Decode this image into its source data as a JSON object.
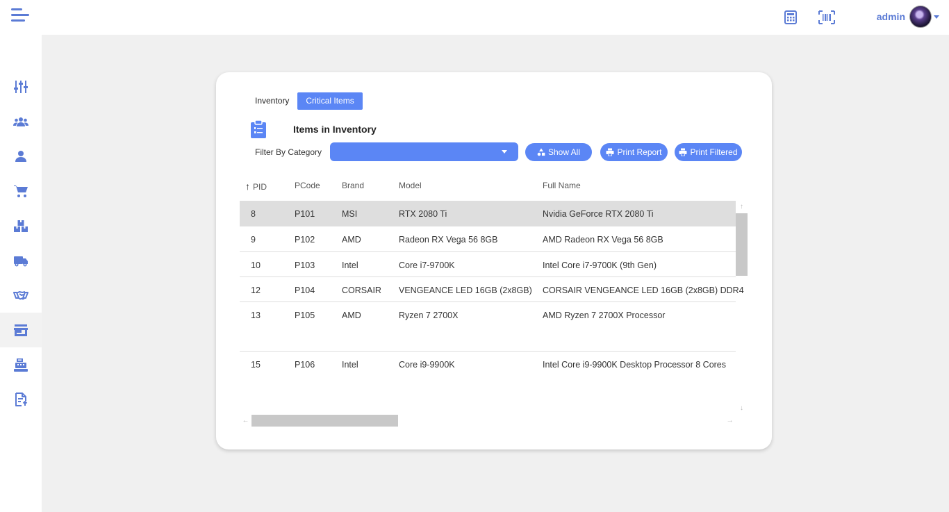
{
  "topbar": {
    "username": "admin"
  },
  "tabs": [
    {
      "label": "Inventory"
    },
    {
      "label": "Critical Items"
    }
  ],
  "page": {
    "title": "Items in Inventory",
    "filter_label": "Filter By Category",
    "filter_value": "",
    "buttons": {
      "show_all": "Show All",
      "print_report": "Print Report",
      "print_filtered": "Print Filtered"
    }
  },
  "table": {
    "columns": [
      "PID",
      "PCode",
      "Brand",
      "Model",
      "Full Name"
    ],
    "sort": {
      "column": "PID",
      "direction": "ascending"
    },
    "rows": [
      {
        "pid": "8",
        "pcode": "P101",
        "brand": "MSI",
        "model": "RTX 2080 Ti",
        "full_name": "Nvidia GeForce RTX 2080 Ti"
      },
      {
        "pid": "9",
        "pcode": "P102",
        "brand": "AMD",
        "model": "Radeon RX Vega 56 8GB",
        "full_name": "AMD Radeon RX Vega 56 8GB"
      },
      {
        "pid": "10",
        "pcode": "P103",
        "brand": "Intel",
        "model": "Core i7-9700K",
        "full_name": "Intel Core i7-9700K (9th Gen)"
      },
      {
        "pid": "12",
        "pcode": "P104",
        "brand": "CORSAIR",
        "model": "VENGEANCE LED 16GB (2x8GB)",
        "full_name": "CORSAIR VENGEANCE LED 16GB (2x8GB) DDR4"
      },
      {
        "pid": "13",
        "pcode": "P105",
        "brand": "AMD",
        "model": "Ryzen 7 2700X",
        "full_name": "AMD Ryzen 7 2700X Processor"
      },
      {
        "pid": "15",
        "pcode": "P106",
        "brand": "Intel",
        "model": "Core i9-9900K",
        "full_name": "Intel Core i9-9900K Desktop Processor 8 Cores"
      }
    ]
  },
  "colors": {
    "accent": "#5b86f5",
    "icon": "#5b7bd5",
    "background": "#f0f0f0",
    "selected_row": "#dedede"
  },
  "icons": {
    "sidebar": [
      "sliders-icon",
      "users-group-icon",
      "user-icon",
      "cart-icon",
      "boxes-icon",
      "truck-icon",
      "handshake-icon",
      "store-icon",
      "cash-register-icon",
      "report-icon"
    ],
    "topbar": [
      "calculator-icon",
      "barcode-icon"
    ]
  }
}
